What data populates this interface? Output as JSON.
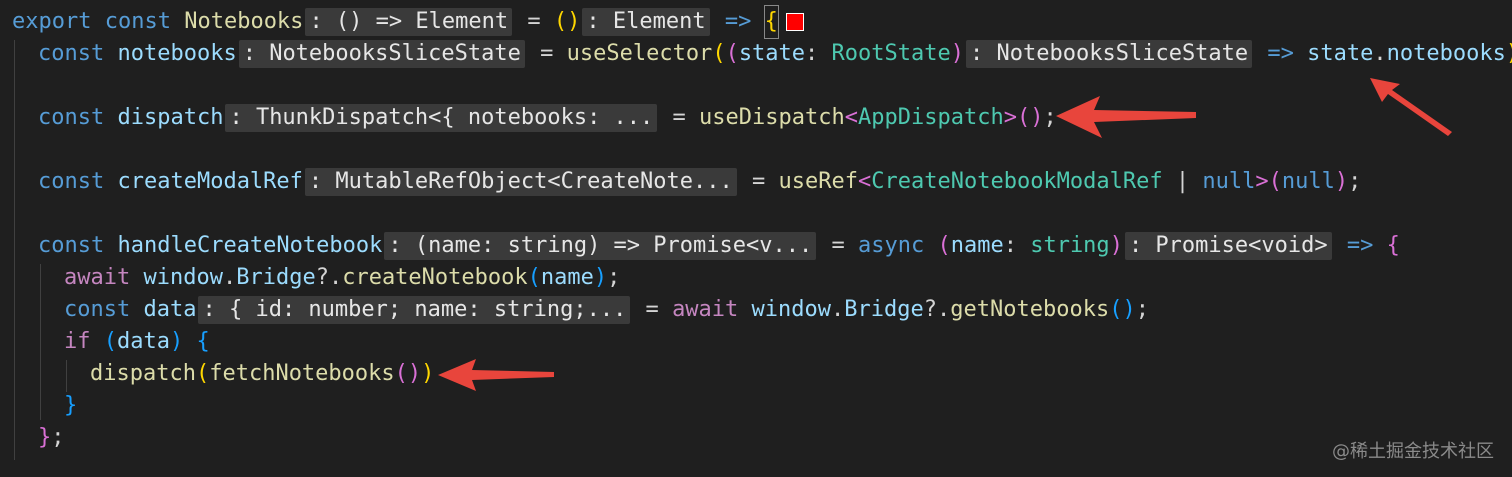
{
  "colors": {
    "swatch": "#ff0000",
    "arrow": "#e8453c"
  },
  "code": {
    "l1": {
      "export": "export",
      "const": "const",
      "name": "Notebooks",
      "hint": ": () => Element",
      "eq": " = ",
      "paren": "()",
      "hint2": ": Element",
      "arrow": "=>",
      "brace": "{"
    },
    "l2": {
      "const": "const",
      "name": "notebooks",
      "hint": ": NotebooksSliceState",
      "eq": " = ",
      "fn": "useSelector",
      "p1": "(",
      "p2": "(",
      "param": "state",
      "colon": ": ",
      "type": "RootState",
      "p3": ")",
      "hint2": ": NotebooksSliceState",
      "arrow": "=>",
      "obj": "state",
      "dot": ".",
      "prop": "notebooks",
      "p4": ")",
      "semi": ";"
    },
    "l3": {
      "const": "const",
      "name": "dispatch",
      "hint": ": ThunkDispatch<{ notebooks: ...",
      "eq": " = ",
      "fn": "useDispatch",
      "lt": "<",
      "type": "AppDispatch",
      "gt": ">",
      "p1": "()",
      "semi": ";"
    },
    "l4": {
      "const": "const",
      "name": "createModalRef",
      "hint": ": MutableRefObject<CreateNote...",
      "eq": " = ",
      "fn": "useRef",
      "lt": "<",
      "type": "CreateNotebookModalRef",
      "bar": " | ",
      "null": "null",
      "gt": ">",
      "p1": "(",
      "arg": "null",
      "p2": ")",
      "semi": ";"
    },
    "l5": {
      "const": "const",
      "name": "handleCreateNotebook",
      "hint": ": (name: string) => Promise<v...",
      "eq": " = ",
      "async": "async",
      "p1": "(",
      "param": "name",
      "colon": ": ",
      "type": "string",
      "p2": ")",
      "hint2": ": Promise<void>",
      "arrow": "=>",
      "brace": "{"
    },
    "l6": {
      "await": "await",
      "win": "window",
      "dot": ".",
      "bridge": "Bridge",
      "opt": "?.",
      "fn": "createNotebook",
      "p1": "(",
      "arg": "name",
      "p2": ")",
      "semi": ";"
    },
    "l7": {
      "const": "const",
      "name": "data",
      "hint": ": { id: number; name: string;...",
      "eq": " = ",
      "await": "await",
      "win": "window",
      "dot": ".",
      "bridge": "Bridge",
      "opt": "?.",
      "fn": "getNotebooks",
      "p1": "()",
      "semi": ";"
    },
    "l8": {
      "if": "if",
      "p1": "(",
      "arg": "data",
      "p2": ")",
      "brace": "{"
    },
    "l9": {
      "fn": "dispatch",
      "p1": "(",
      "fn2": "fetchNotebooks",
      "p2": "()",
      "p3": ")"
    },
    "l10": {
      "brace": "}"
    },
    "l11": {
      "brace": "}",
      "semi": ";"
    }
  },
  "watermark": "@稀土掘金技术社区"
}
